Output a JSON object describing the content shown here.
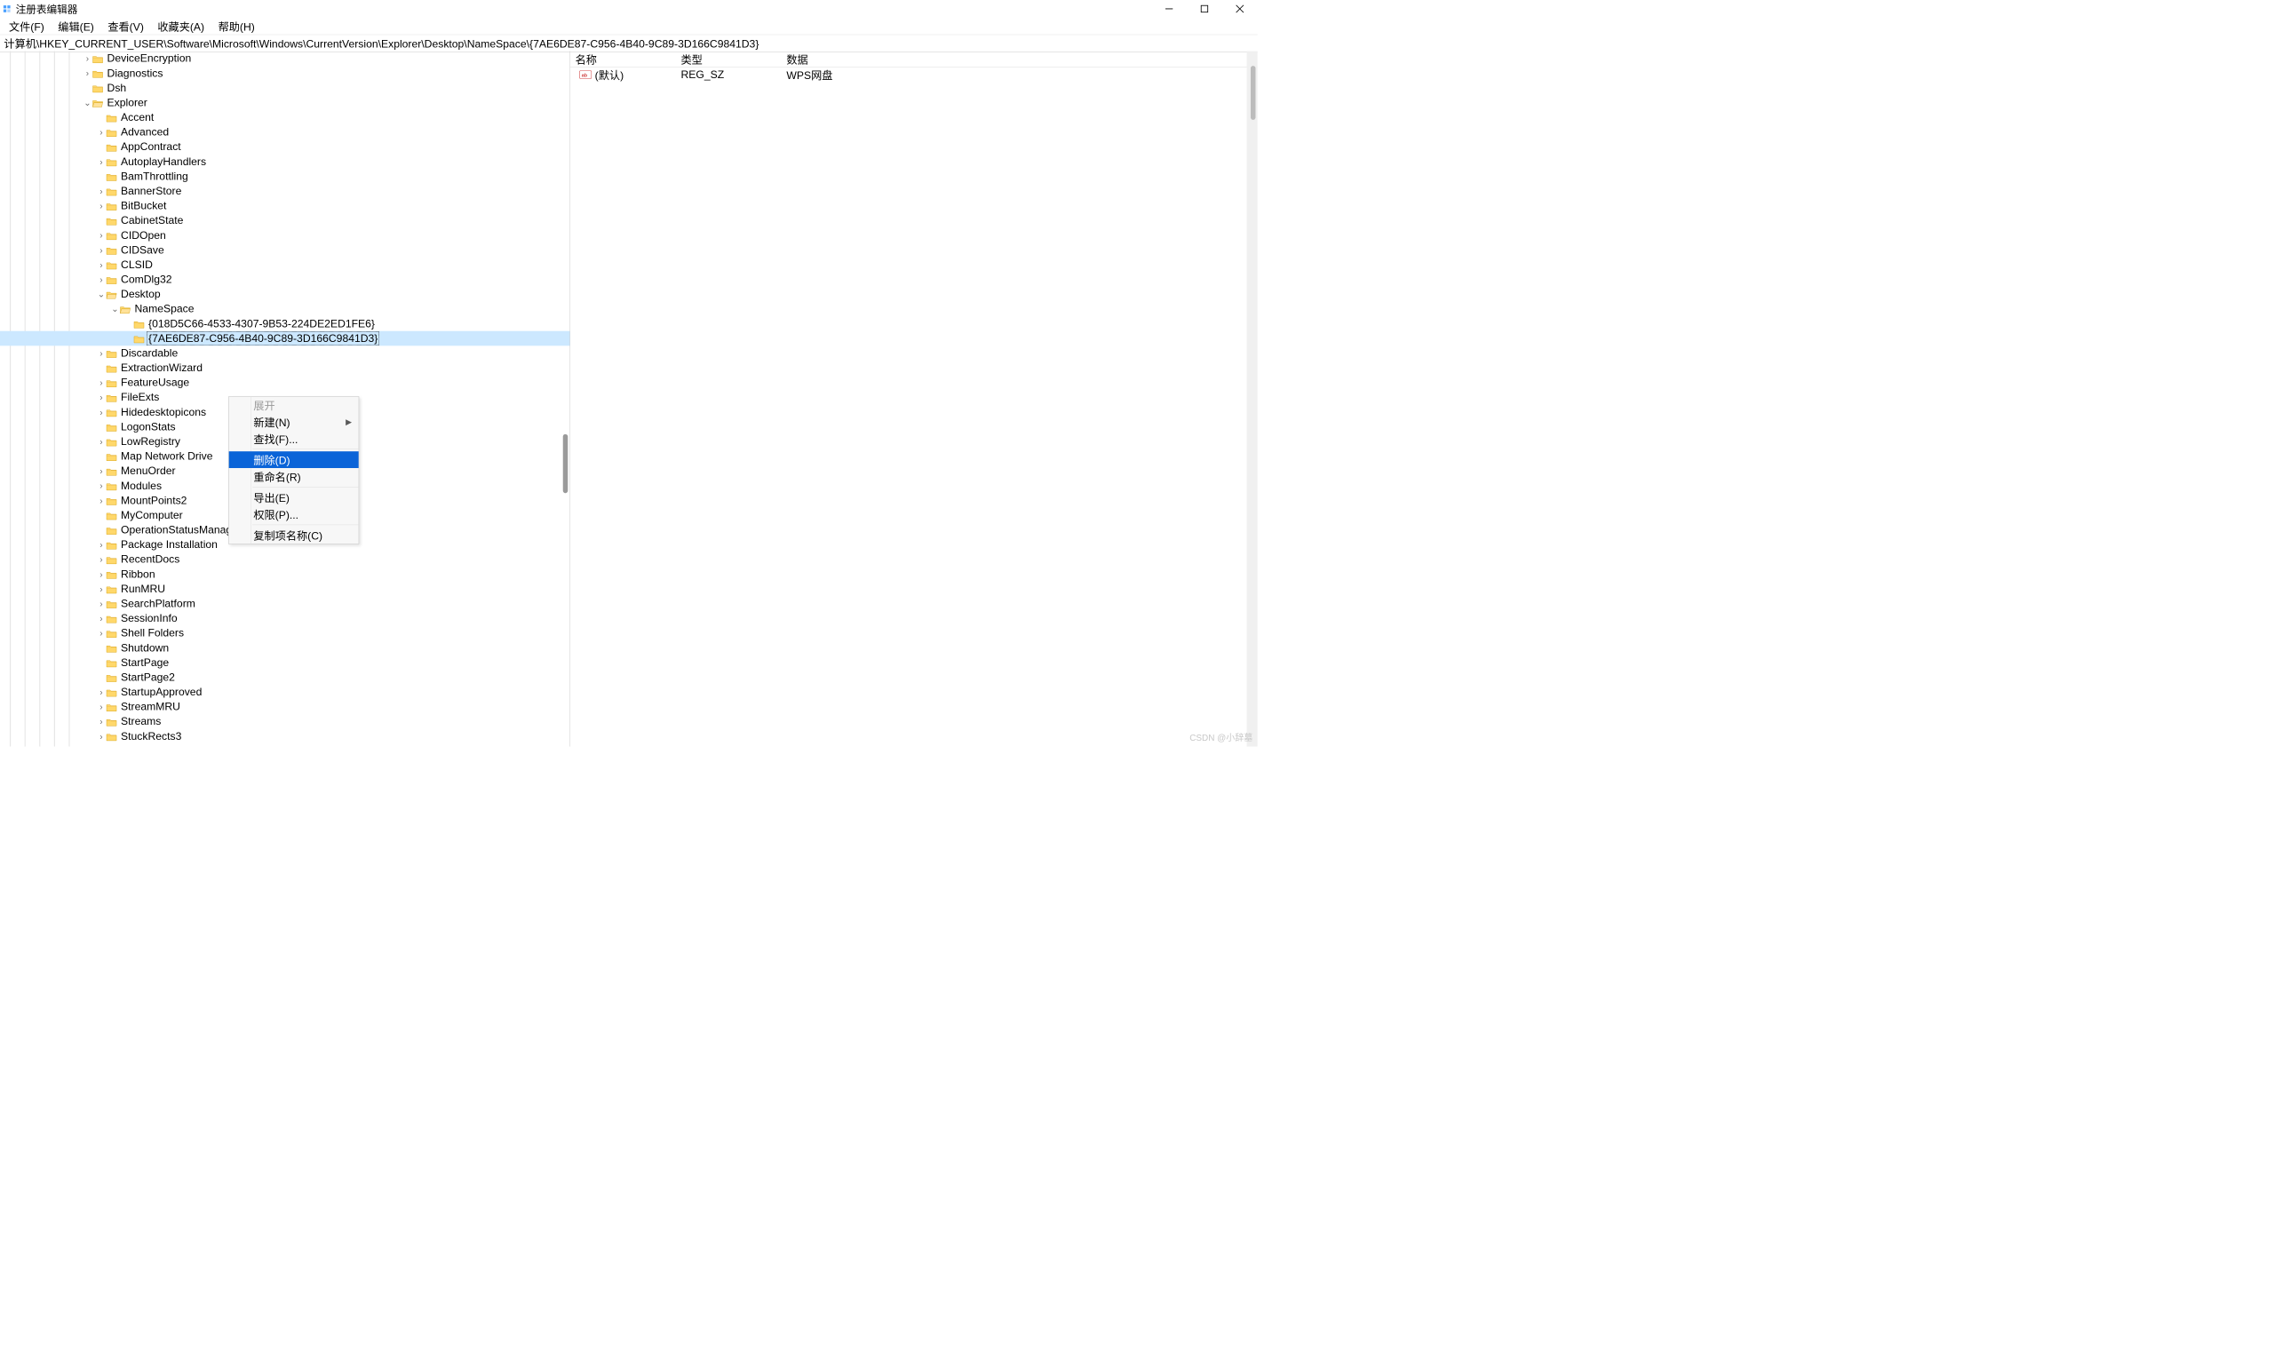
{
  "title": "注册表编辑器",
  "menu": [
    "文件(F)",
    "编辑(E)",
    "查看(V)",
    "收藏夹(A)",
    "帮助(H)"
  ],
  "address": "计算机\\HKEY_CURRENT_USER\\Software\\Microsoft\\Windows\\CurrentVersion\\Explorer\\Desktop\\NameSpace\\{7AE6DE87-C956-4B40-9C89-3D166C9841D3}",
  "list": {
    "headers": {
      "name": "名称",
      "type": "类型",
      "data": "数据"
    },
    "rows": [
      {
        "name": "(默认)",
        "type": "REG_SZ",
        "data": "WPS网盘"
      }
    ]
  },
  "tree": [
    {
      "indent": 6,
      "exp": ">",
      "label": "DeviceEncryption"
    },
    {
      "indent": 6,
      "exp": ">",
      "label": "Diagnostics"
    },
    {
      "indent": 6,
      "exp": "",
      "label": "Dsh"
    },
    {
      "indent": 6,
      "exp": "v",
      "label": "Explorer",
      "open": true
    },
    {
      "indent": 7,
      "exp": "",
      "label": "Accent"
    },
    {
      "indent": 7,
      "exp": ">",
      "label": "Advanced"
    },
    {
      "indent": 7,
      "exp": "",
      "label": "AppContract"
    },
    {
      "indent": 7,
      "exp": ">",
      "label": "AutoplayHandlers"
    },
    {
      "indent": 7,
      "exp": "",
      "label": "BamThrottling"
    },
    {
      "indent": 7,
      "exp": ">",
      "label": "BannerStore"
    },
    {
      "indent": 7,
      "exp": ">",
      "label": "BitBucket"
    },
    {
      "indent": 7,
      "exp": "",
      "label": "CabinetState"
    },
    {
      "indent": 7,
      "exp": ">",
      "label": "CIDOpen"
    },
    {
      "indent": 7,
      "exp": ">",
      "label": "CIDSave"
    },
    {
      "indent": 7,
      "exp": ">",
      "label": "CLSID"
    },
    {
      "indent": 7,
      "exp": ">",
      "label": "ComDlg32"
    },
    {
      "indent": 7,
      "exp": "v",
      "label": "Desktop",
      "open": true
    },
    {
      "indent": 8,
      "exp": "v",
      "label": "NameSpace",
      "open": true
    },
    {
      "indent": 9,
      "exp": "",
      "label": "{018D5C66-4533-4307-9B53-224DE2ED1FE6}"
    },
    {
      "indent": 9,
      "exp": "",
      "label": "{7AE6DE87-C956-4B40-9C89-3D166C9841D3}",
      "selected": true
    },
    {
      "indent": 7,
      "exp": ">",
      "label": "Discardable"
    },
    {
      "indent": 7,
      "exp": "",
      "label": "ExtractionWizard"
    },
    {
      "indent": 7,
      "exp": ">",
      "label": "FeatureUsage"
    },
    {
      "indent": 7,
      "exp": ">",
      "label": "FileExts"
    },
    {
      "indent": 7,
      "exp": ">",
      "label": "Hidedesktopicons"
    },
    {
      "indent": 7,
      "exp": "",
      "label": "LogonStats"
    },
    {
      "indent": 7,
      "exp": ">",
      "label": "LowRegistry"
    },
    {
      "indent": 7,
      "exp": "",
      "label": "Map Network Drive"
    },
    {
      "indent": 7,
      "exp": ">",
      "label": "MenuOrder"
    },
    {
      "indent": 7,
      "exp": ">",
      "label": "Modules"
    },
    {
      "indent": 7,
      "exp": ">",
      "label": "MountPoints2"
    },
    {
      "indent": 7,
      "exp": "",
      "label": "MyComputer"
    },
    {
      "indent": 7,
      "exp": "",
      "label": "OperationStatusManager"
    },
    {
      "indent": 7,
      "exp": ">",
      "label": "Package Installation"
    },
    {
      "indent": 7,
      "exp": ">",
      "label": "RecentDocs"
    },
    {
      "indent": 7,
      "exp": ">",
      "label": "Ribbon"
    },
    {
      "indent": 7,
      "exp": ">",
      "label": "RunMRU"
    },
    {
      "indent": 7,
      "exp": ">",
      "label": "SearchPlatform"
    },
    {
      "indent": 7,
      "exp": ">",
      "label": "SessionInfo"
    },
    {
      "indent": 7,
      "exp": ">",
      "label": "Shell Folders"
    },
    {
      "indent": 7,
      "exp": "",
      "label": "Shutdown"
    },
    {
      "indent": 7,
      "exp": "",
      "label": "StartPage"
    },
    {
      "indent": 7,
      "exp": "",
      "label": "StartPage2"
    },
    {
      "indent": 7,
      "exp": ">",
      "label": "StartupApproved"
    },
    {
      "indent": 7,
      "exp": ">",
      "label": "StreamMRU"
    },
    {
      "indent": 7,
      "exp": ">",
      "label": "Streams"
    },
    {
      "indent": 7,
      "exp": ">",
      "label": "StuckRects3"
    }
  ],
  "context_menu": [
    {
      "label": "展开",
      "disabled": true
    },
    {
      "label": "新建(N)",
      "submenu": true
    },
    {
      "label": "查找(F)..."
    },
    {
      "sep": true
    },
    {
      "label": "删除(D)",
      "hover": true
    },
    {
      "label": "重命名(R)"
    },
    {
      "sep": true
    },
    {
      "label": "导出(E)"
    },
    {
      "label": "权限(P)..."
    },
    {
      "sep": true
    },
    {
      "label": "复制项名称(C)"
    }
  ],
  "watermark": "CSDN @小辞墓"
}
